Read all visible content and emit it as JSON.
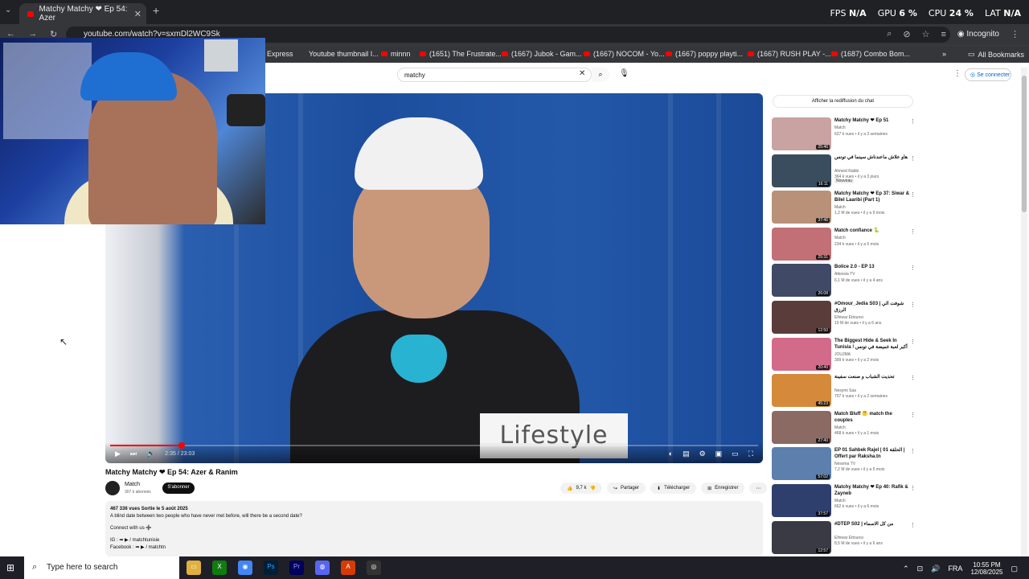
{
  "browser": {
    "tab_title": "Matchy Matchy ❤ Ep 54: Azer",
    "url": "youtube.com/watch?v=sxmDl2WC9Sk",
    "incognito_label": "Incognito",
    "all_bookmarks": "All Bookmarks",
    "bookmarks": [
      "Express",
      "Youtube thumbnail I...",
      "minnn",
      "(1651) The Frustrate...",
      "(1667) Jubok - Gam...",
      "(1667) NOCOM - Yo...",
      "(1667) poppy playti...",
      "(1667) RUSH PLAY -...",
      "(1687) Combo Bom..."
    ]
  },
  "hud": {
    "fps_label": "FPS",
    "fps_value": "N/A",
    "gpu_label": "GPU",
    "gpu_value": "6 %",
    "cpu_label": "CPU",
    "cpu_value": "24 %",
    "lat_label": "LAT",
    "lat_value": "N/A"
  },
  "youtube": {
    "search_value": "matchy",
    "connect_label": "Se connecter",
    "video": {
      "title": "Matchy Matchy ❤ Ep 54: Azer & Ranim",
      "overlay_text": "Lifestyle",
      "time": "2:35 / 23:03",
      "progress": 0.11
    },
    "channel": {
      "name": "Match",
      "subs": "307 k abonnés",
      "subscribe": "S'abonner"
    },
    "actions": {
      "likes": "9,7 k",
      "share": "Partager",
      "download": "Télécharger",
      "save": "Enregistrer"
    },
    "description": {
      "stats": "467 336 vues  Sortie le 5 août 2025",
      "line1": "A blind date between two people who have never met before, will there be a second date?",
      "line2": "Connect with us ➕",
      "line3": "IG : ➡ ▶ / matchtunisie",
      "line4": "Facebook : ➡ ▶ / matchtn"
    },
    "chat_replay": "Afficher la rediffusion du chat",
    "recommendations": [
      {
        "title": "Matchy Matchy ❤ Ep 51",
        "channel": "Match",
        "meta": "627 k vues • il y a 3 semaines",
        "duration": "25:46",
        "color": "#c9a2a2"
      },
      {
        "title": "هاو علاش ماعندناش سينما في تونس",
        "channel": "Ahmed Rabbi",
        "meta": "364 k vues • il y a 3 jours",
        "duration": "16:11",
        "color": "#3a4d5e",
        "badge": "Nouveau"
      },
      {
        "title": "Matchy Matchy ❤ Ep 37: Siwar & Bilel Laaribi (Part 1)",
        "channel": "Match",
        "meta": "1,2 M de vues • il y a 9 mois",
        "duration": "37:46",
        "color": "#b99178"
      },
      {
        "title": "Match confiance 🐍",
        "channel": "Match",
        "meta": "234 k vues • il y a 5 mois",
        "duration": "25:31",
        "color": "#c26f76"
      },
      {
        "title": "Bolice 2.0 - EP 13",
        "channel": "Attessia TV",
        "meta": "6,1 M de vues • il y a 4 ans",
        "duration": "26:08",
        "color": "#404a66"
      },
      {
        "title": "#Omour_Jedia S03 | شوفت الي الرزق",
        "channel": "Elhiwar Ettounsi",
        "meta": "10 M de vues • il y a 6 ans",
        "duration": "12:50",
        "color": "#5a3d3a"
      },
      {
        "title": "The Biggest Hide & Seek In Tunisia ! أكبر لعبة غميضة في تونس",
        "channel": "JOUJMA",
        "meta": "399 k vues • il y a 2 mois",
        "duration": "20:40",
        "color": "#d26a8a"
      },
      {
        "title": "تحديت الشباب و صنعت سفينة",
        "channel": "Nesymi Saa",
        "meta": "707 k vues • il y a 2 semaines",
        "duration": "45:23",
        "color": "#d48a3a"
      },
      {
        "title": "Match Bluff 🤔 match the couples",
        "channel": "Match",
        "meta": "468 k vues • il y a 1 mois",
        "duration": "27:40",
        "color": "#8a6a62"
      },
      {
        "title": "EP 01 Sahbek Rajel | الحلقة 01 | Offert par Raksha.tn",
        "channel": "Nessma TV",
        "meta": "7,2 M de vues • il y a 5 mois",
        "duration": "57:02",
        "color": "#5c7fae"
      },
      {
        "title": "Matchy Matchy ❤ Ep 40: Rafik & Zayneb",
        "channel": "Match",
        "meta": "662 k vues • il y a 6 mois",
        "duration": "37:57",
        "color": "#2f3f6d"
      },
      {
        "title": "#DTEP S02 | من كل الاسماء",
        "channel": "Elhiwar Ettounsi",
        "meta": "8,5 M de vues • il y a 6 ans",
        "duration": "12:57",
        "color": "#3a3a44"
      }
    ]
  },
  "taskbar": {
    "search_placeholder": "Type here to search",
    "lang": "FRA",
    "time": "10:55 PM",
    "date": "12/08/2025"
  }
}
